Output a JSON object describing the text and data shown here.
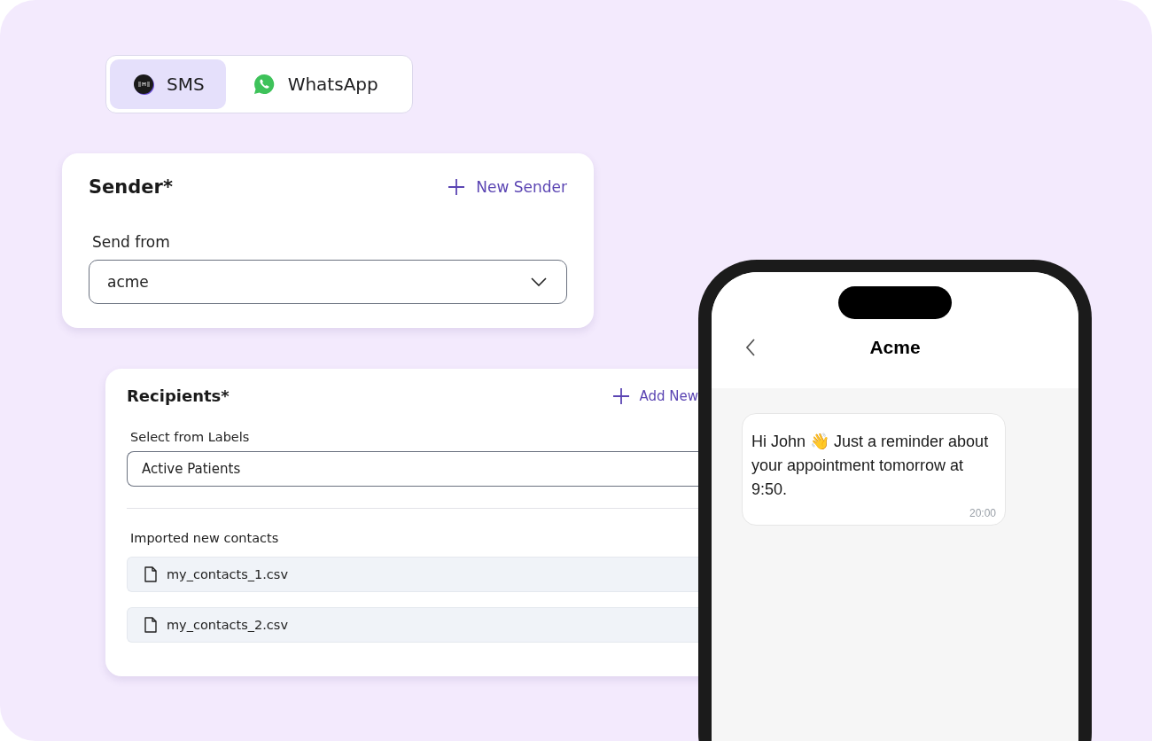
{
  "channel_tabs": [
    {
      "label": "SMS",
      "kind": "sms",
      "selected": true
    },
    {
      "label": "WhatsApp",
      "kind": "whatsapp",
      "selected": false
    }
  ],
  "sender": {
    "title": "Sender*",
    "action": "New Sender",
    "field_label": "Send from",
    "value": "acme"
  },
  "recipients": {
    "title": "Recipients*",
    "action": "Add New",
    "field_label": "Select from Labels",
    "value": "Active Patients",
    "imported_label": "Imported new contacts",
    "files": [
      "my_contacts_1.csv",
      "my_contacts_2.csv"
    ]
  },
  "phone": {
    "contact": "Acme",
    "message": "Hi John 👋 Just a reminder about your appointment tomorrow at 9:50.",
    "time": "20:00"
  }
}
